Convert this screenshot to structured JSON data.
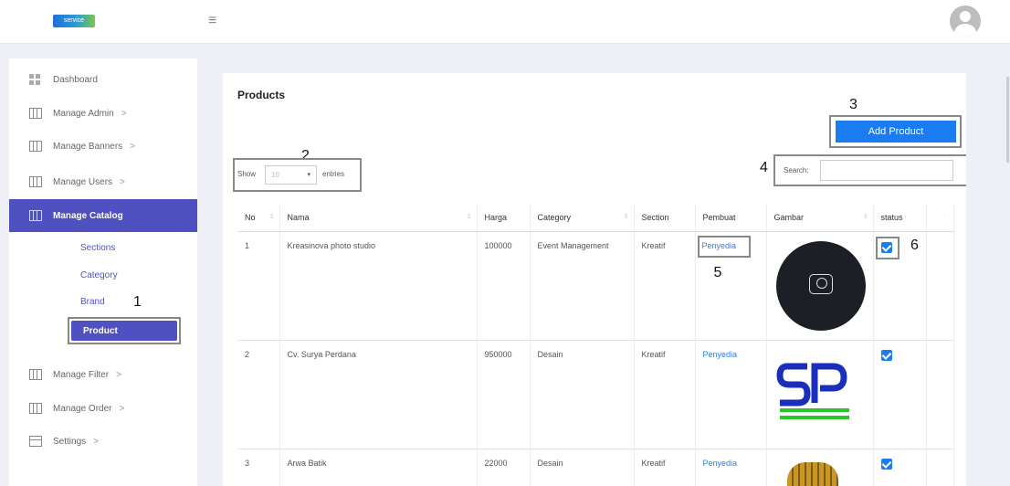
{
  "app": {
    "logo_text": "service",
    "menu_toggle_icon": "hamburger-icon",
    "avatar_icon": "user-avatar-icon"
  },
  "sidebar": {
    "items": [
      {
        "label": "Dashboard",
        "icon": "grid-icon",
        "chevron": ""
      },
      {
        "label": "Manage Admin",
        "icon": "table-icon",
        "chevron": ">"
      },
      {
        "label": "Manage Banners",
        "icon": "table-icon",
        "chevron": ">"
      },
      {
        "label": "Manage Users",
        "icon": "table-icon",
        "chevron": ">"
      },
      {
        "label": "Manage Catalog",
        "icon": "table-icon",
        "chevron": ""
      },
      {
        "label": "Manage Filter",
        "icon": "table-icon",
        "chevron": ">"
      },
      {
        "label": "Manage Order",
        "icon": "table-icon",
        "chevron": ">"
      },
      {
        "label": "Settings",
        "icon": "calendar-icon",
        "chevron": ">"
      }
    ],
    "catalog_sub": [
      "Sections",
      "Category",
      "Brand",
      "Product"
    ]
  },
  "annotations": [
    "1",
    "2",
    "3",
    "4",
    "5",
    "6"
  ],
  "main": {
    "title": "Products",
    "add_button": "Add Product",
    "show_label": "Show",
    "entries_value": "10",
    "entries_label": "entries",
    "search_label": "Search:",
    "search_value": ""
  },
  "table": {
    "headers": [
      "No",
      "Nama",
      "Harga",
      "Category",
      "Section",
      "Pembuat",
      "Gambar",
      "status",
      ""
    ],
    "rows": [
      {
        "no": "1",
        "nama": "Kreasinova photo studio",
        "harga": "100000",
        "category": "Event Management",
        "section": "Kreatif",
        "pembuat": "Penyedia",
        "image": "camera-logo-image",
        "status": true
      },
      {
        "no": "2",
        "nama": "Cv. Surya Perdana",
        "harga": "950000",
        "category": "Desain",
        "section": "Kreatif",
        "pembuat": "Penyedia",
        "image": "sp-logo-image",
        "status": true
      },
      {
        "no": "3",
        "nama": "Arwa Batik",
        "harga": "22000",
        "category": "Desain",
        "section": "Kreatif",
        "pembuat": "Penyedia",
        "image": "batik-image",
        "status": true
      }
    ]
  },
  "colors": {
    "accent": "#4f51c0",
    "primary_button": "#1a7cf0",
    "link": "#2f7fe8"
  }
}
